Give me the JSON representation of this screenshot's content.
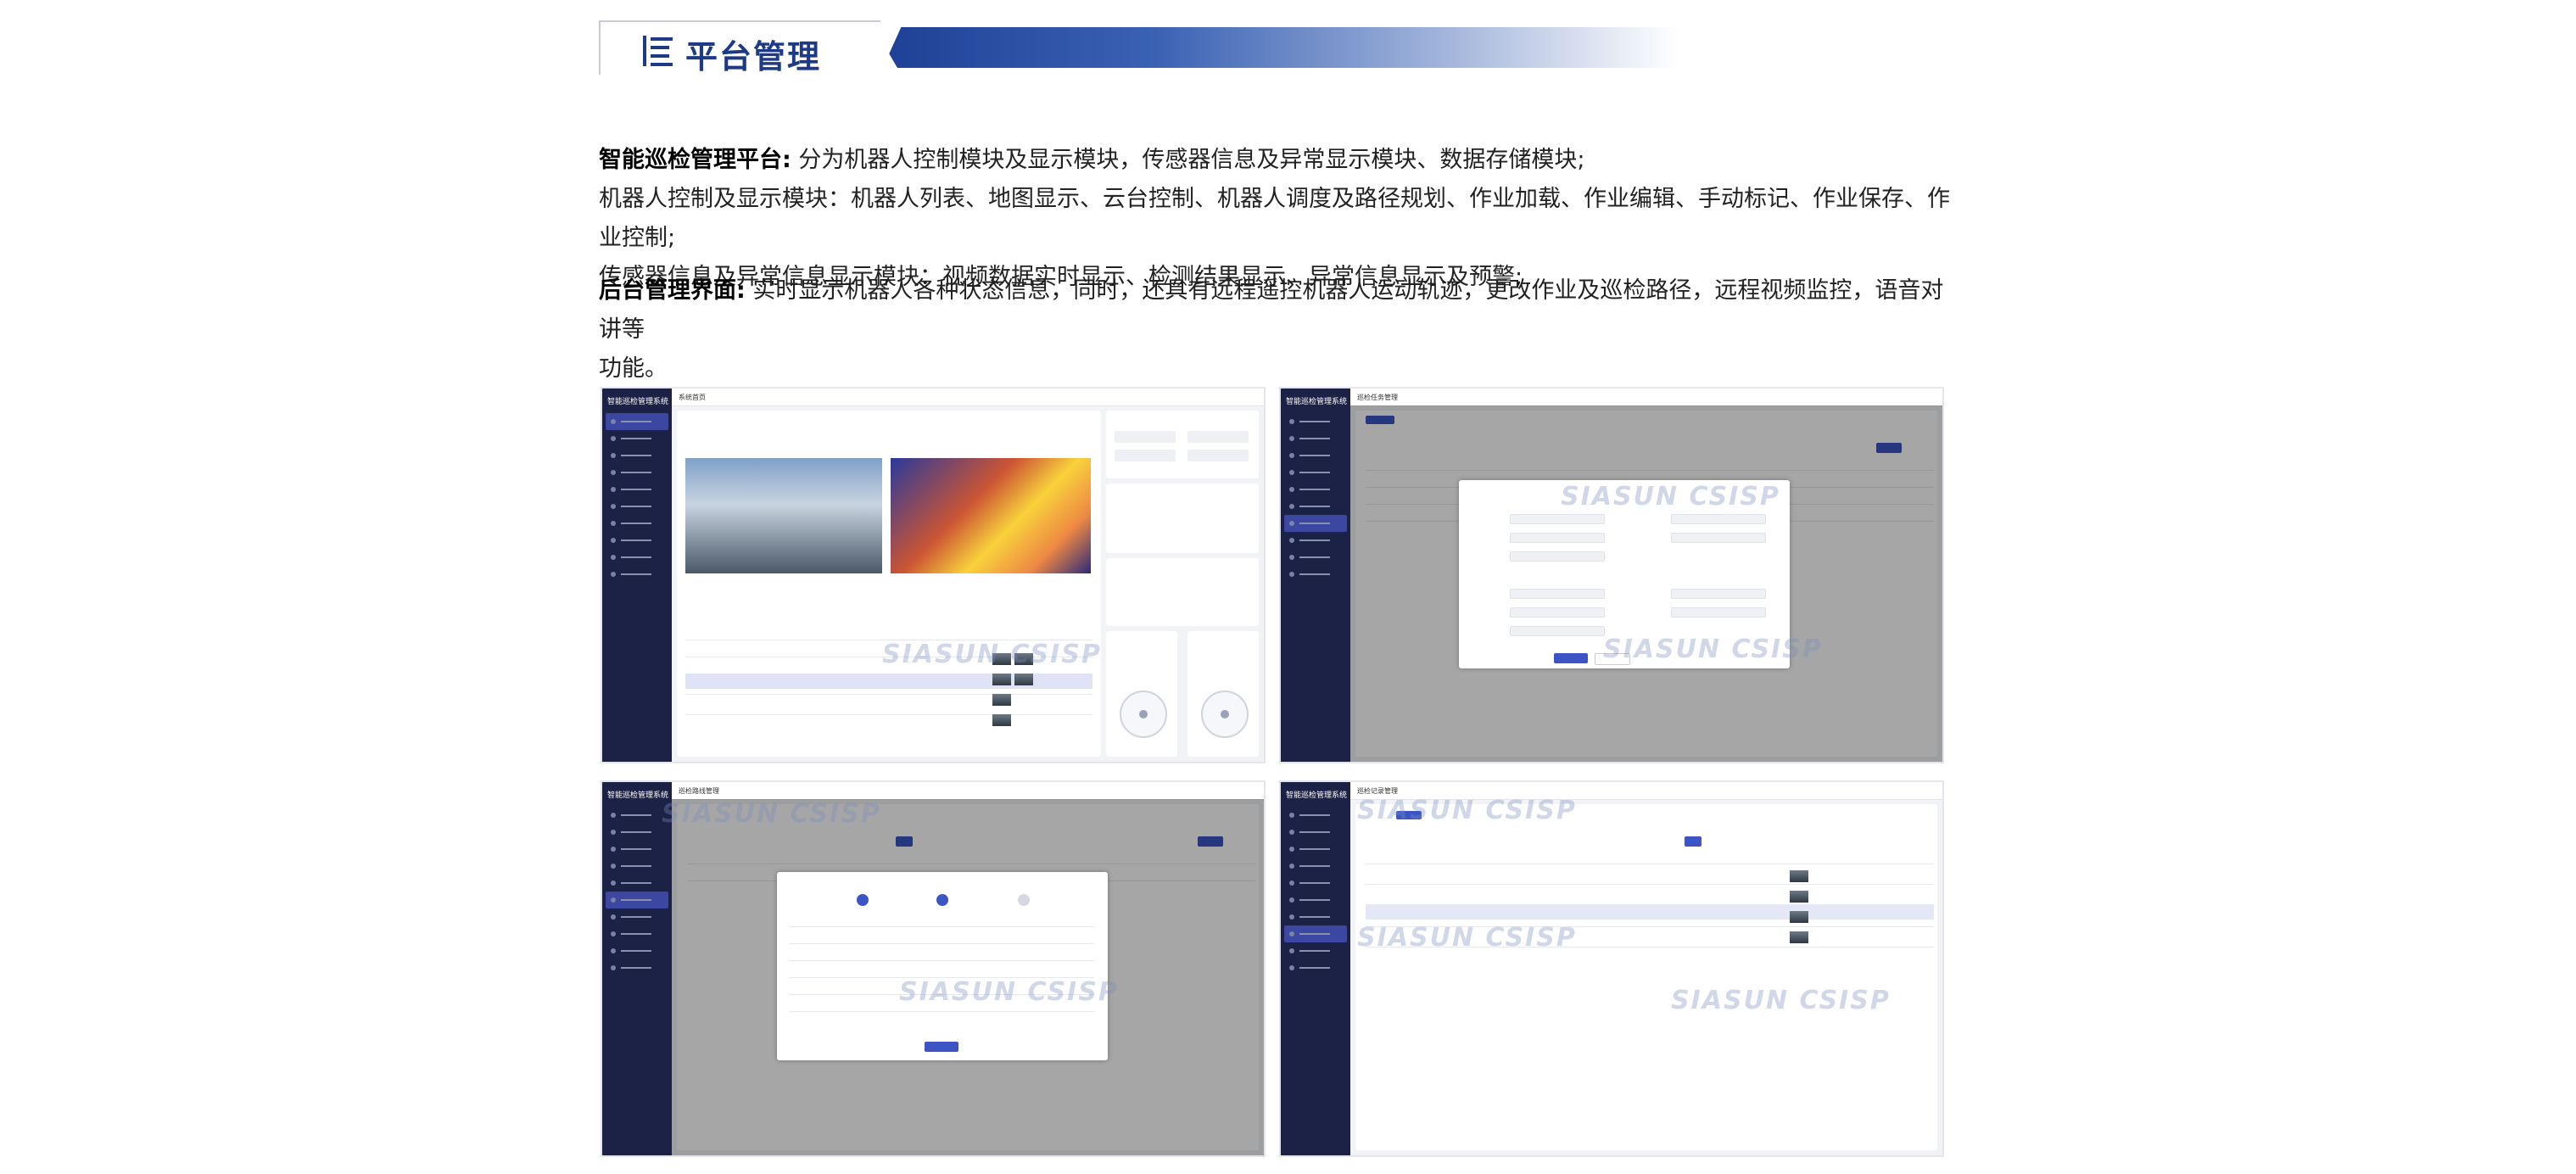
{
  "header": {
    "title": "平台管理"
  },
  "sections": [
    {
      "label": "智能巡检管理平台:",
      "lines": [
        "分为机器人控制模块及显示模块，传感器信息及异常显示模块、数据存储模块;",
        "机器人控制及显示模块：机器人列表、地图显示、云台控制、机器人调度及路径规划、作业加载、作业编辑、手动标记、作业保存、作业控制;",
        "传感器信息及异常信息显示模块：视频数据实时显示、检测结果显示、异常信息显示及预警;"
      ]
    },
    {
      "label": "后台管理界面:",
      "lines": [
        "实时显示机器人各种状态信息，同时，还具有远程遥控机器人运动轨迹，更改作业及巡检路径，远程视频监控，语音对讲等",
        "功能。"
      ]
    }
  ],
  "screenshots": {
    "app_title": "智能巡检管理系统",
    "panel1_title": "系统首页",
    "panel2_title": "巡检任务管理",
    "panel3_title": "巡检路线管理",
    "panel4_title": "巡检记录管理",
    "watermark": "SIASUN  CSISP"
  },
  "colors": {
    "brand_blue": "#1c3a86",
    "sidebar": "#1c2246",
    "accent": "#3d55c4"
  }
}
